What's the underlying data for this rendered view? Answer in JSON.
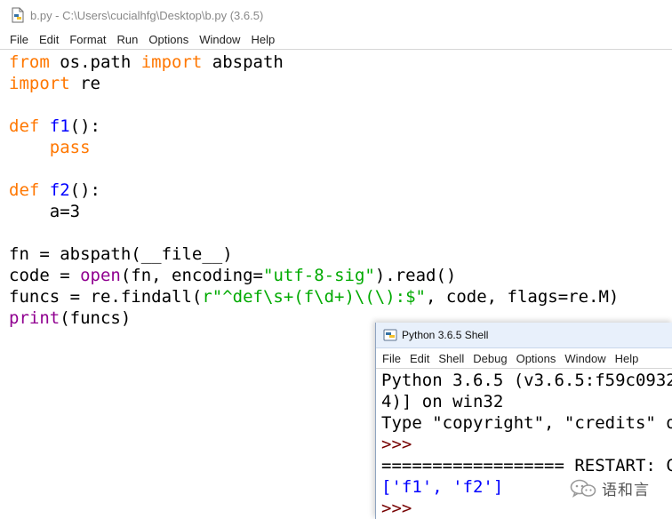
{
  "editor": {
    "title": "b.py - C:\\Users\\cucialhfg\\Desktop\\b.py (3.6.5)",
    "menu": [
      "File",
      "Edit",
      "Format",
      "Run",
      "Options",
      "Window",
      "Help"
    ],
    "code_lines": [
      [
        {
          "t": "from",
          "c": "kw"
        },
        {
          "t": " os.path ",
          "c": ""
        },
        {
          "t": "import",
          "c": "kw"
        },
        {
          "t": " abspath",
          "c": ""
        }
      ],
      [
        {
          "t": "import",
          "c": "kw"
        },
        {
          "t": " re",
          "c": ""
        }
      ],
      [],
      [
        {
          "t": "def",
          "c": "kw"
        },
        {
          "t": " ",
          "c": ""
        },
        {
          "t": "f1",
          "c": "df"
        },
        {
          "t": "():",
          "c": ""
        }
      ],
      [
        {
          "t": "    ",
          "c": ""
        },
        {
          "t": "pass",
          "c": "kw"
        }
      ],
      [],
      [
        {
          "t": "def",
          "c": "kw"
        },
        {
          "t": " ",
          "c": ""
        },
        {
          "t": "f2",
          "c": "df"
        },
        {
          "t": "():",
          "c": ""
        }
      ],
      [
        {
          "t": "    a=3",
          "c": ""
        }
      ],
      [],
      [
        {
          "t": "fn = abspath(__file__)",
          "c": ""
        }
      ],
      [
        {
          "t": "code = ",
          "c": ""
        },
        {
          "t": "open",
          "c": "bi"
        },
        {
          "t": "(fn, encoding=",
          "c": ""
        },
        {
          "t": "\"utf-8-sig\"",
          "c": "st"
        },
        {
          "t": ").read()",
          "c": ""
        }
      ],
      [
        {
          "t": "funcs = re.findall(",
          "c": ""
        },
        {
          "t": "r\"^def\\s+(f\\d+)\\(\\):$\"",
          "c": "st"
        },
        {
          "t": ", code, flags=re.M)",
          "c": ""
        }
      ],
      [
        {
          "t": "print",
          "c": "bi"
        },
        {
          "t": "(funcs)",
          "c": ""
        }
      ]
    ]
  },
  "shell": {
    "title": "Python 3.6.5 Shell",
    "menu": [
      "File",
      "Edit",
      "Shell",
      "Debug",
      "Options",
      "Window",
      "Help"
    ],
    "output_lines": [
      [
        {
          "t": "Python 3.6.5 (v3.6.5:f59c0932",
          "c": ""
        }
      ],
      [
        {
          "t": "4)] on win32",
          "c": ""
        }
      ],
      [
        {
          "t": "Type \"copyright\", \"credits\" o",
          "c": ""
        }
      ],
      [
        {
          "t": ">>> ",
          "c": "prompt"
        }
      ],
      [
        {
          "t": "================== RESTART: C",
          "c": ""
        }
      ],
      [
        {
          "t": "['f1', 'f2']",
          "c": "result"
        }
      ],
      [
        {
          "t": ">>> ",
          "c": "prompt"
        }
      ]
    ]
  },
  "watermark": {
    "text": "语和言"
  },
  "colors": {
    "keyword": "#ff7700",
    "builtin": "#900090",
    "definition": "#0000ff",
    "string": "#00aa00",
    "prompt": "#770000",
    "result": "#0000ff"
  }
}
